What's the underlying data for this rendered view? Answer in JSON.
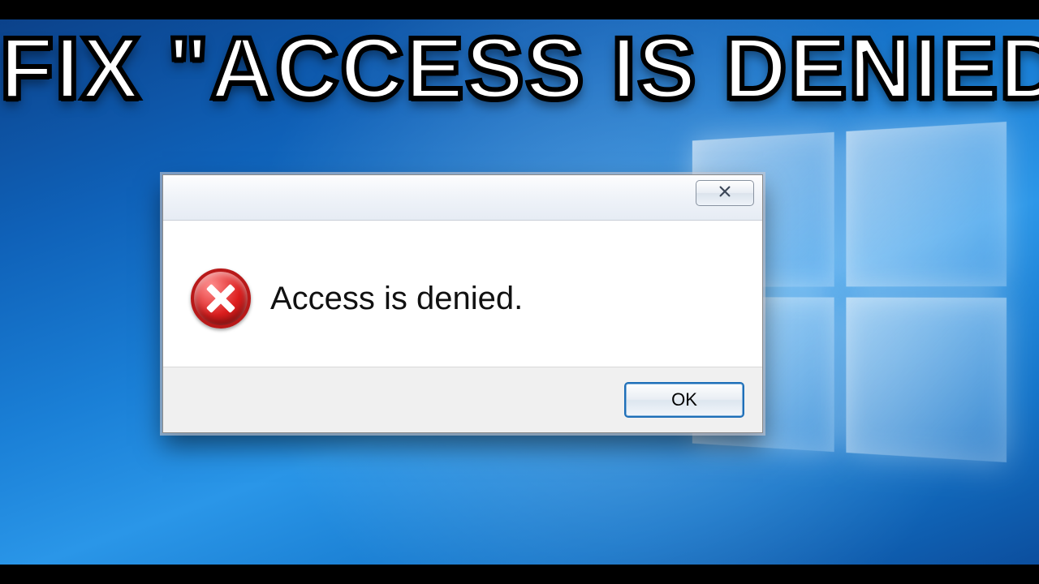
{
  "headline": "FIX \"ACCESS IS DENIED\"",
  "dialog": {
    "message": "Access is denied.",
    "ok_label": "OK"
  }
}
